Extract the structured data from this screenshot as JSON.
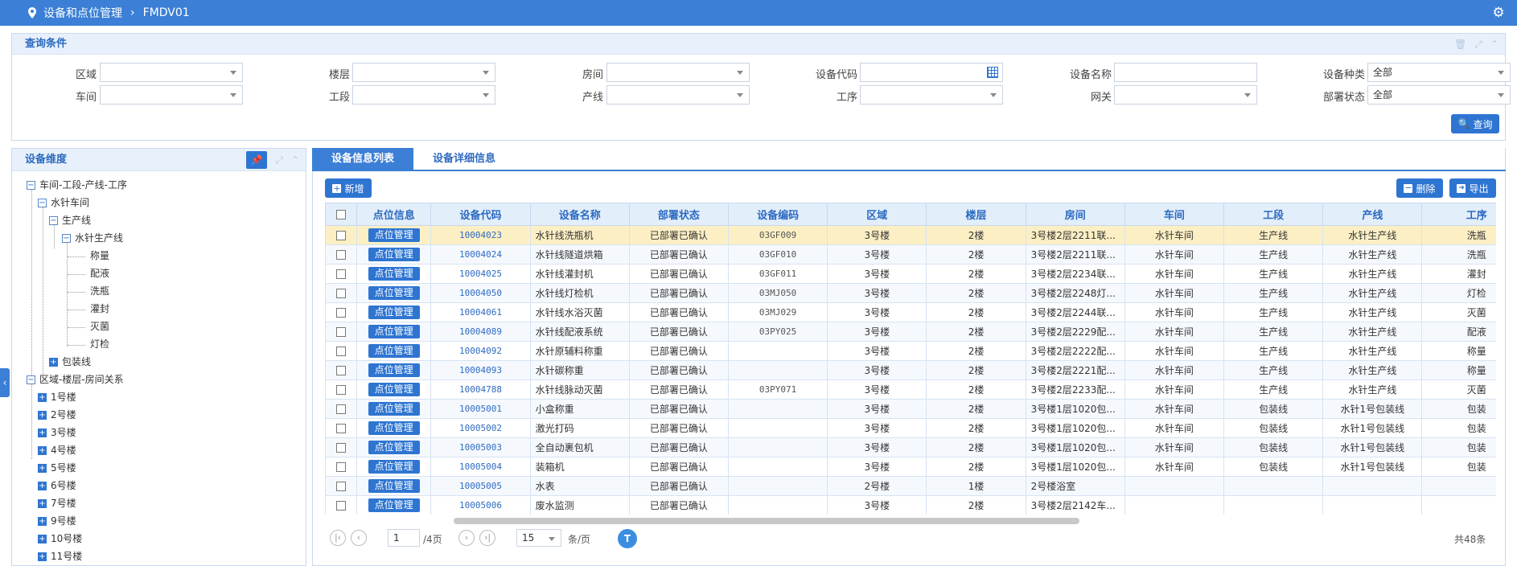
{
  "header": {
    "title": "设备和点位管理",
    "subtitle": "FMDV01"
  },
  "query": {
    "title": "查询条件",
    "row1": [
      {
        "label": "区域",
        "value": "",
        "type": "select"
      },
      {
        "label": "楼层",
        "value": "",
        "type": "select"
      },
      {
        "label": "房间",
        "value": "",
        "type": "select"
      },
      {
        "label": "设备代码",
        "value": "",
        "type": "calendar"
      },
      {
        "label": "设备名称",
        "value": "",
        "type": "text"
      },
      {
        "label": "设备种类",
        "value": "全部",
        "type": "select"
      }
    ],
    "row2": [
      {
        "label": "车间",
        "value": "",
        "type": "select"
      },
      {
        "label": "工段",
        "value": "",
        "type": "select"
      },
      {
        "label": "产线",
        "value": "",
        "type": "select"
      },
      {
        "label": "工序",
        "value": "",
        "type": "select"
      },
      {
        "label": "网关",
        "value": "",
        "type": "select"
      },
      {
        "label": "部署状态",
        "value": "全部",
        "type": "select"
      }
    ],
    "search_label": "查询"
  },
  "tree": {
    "title": "设备维度",
    "root1": "车间-工段-产线-工序",
    "workshop": "水针车间",
    "section": "生产线",
    "line": "水针生产线",
    "processes": [
      "称量",
      "配液",
      "洗瓶",
      "灌封",
      "灭菌",
      "灯检"
    ],
    "pack": "包装线",
    "root2": "区域-楼层-房间关系",
    "buildings": [
      "1号楼",
      "2号楼",
      "3号楼",
      "4号楼",
      "5号楼",
      "6号楼",
      "7号楼",
      "9号楼",
      "10号楼",
      "11号楼"
    ]
  },
  "tabs": [
    "设备信息列表",
    "设备详细信息"
  ],
  "toolbar": {
    "add": "新增",
    "delete": "删除",
    "export": "导出"
  },
  "columns": [
    "点位信息",
    "设备代码",
    "设备名称",
    "部署状态",
    "设备编码",
    "区域",
    "楼层",
    "房间",
    "车间",
    "工段",
    "产线",
    "工序"
  ],
  "point_button": "点位管理",
  "rows": [
    [
      "10004023",
      "水针线洗瓶机",
      "已部署已确认",
      "03GF009",
      "3号楼",
      "2楼",
      "3号楼2层2211联...",
      "水针车间",
      "生产线",
      "水针生产线",
      "洗瓶"
    ],
    [
      "10004024",
      "水针线隧道烘箱",
      "已部署已确认",
      "03GF010",
      "3号楼",
      "2楼",
      "3号楼2层2211联...",
      "水针车间",
      "生产线",
      "水针生产线",
      "洗瓶"
    ],
    [
      "10004025",
      "水针线灌封机",
      "已部署已确认",
      "03GF011",
      "3号楼",
      "2楼",
      "3号楼2层2234联...",
      "水针车间",
      "生产线",
      "水针生产线",
      "灌封"
    ],
    [
      "10004050",
      "水针线灯检机",
      "已部署已确认",
      "03MJ050",
      "3号楼",
      "2楼",
      "3号楼2层2248灯...",
      "水针车间",
      "生产线",
      "水针生产线",
      "灯检"
    ],
    [
      "10004061",
      "水针线水浴灭菌",
      "已部署已确认",
      "03MJ029",
      "3号楼",
      "2楼",
      "3号楼2层2244联...",
      "水针车间",
      "生产线",
      "水针生产线",
      "灭菌"
    ],
    [
      "10004089",
      "水针线配液系统",
      "已部署已确认",
      "03PY025",
      "3号楼",
      "2楼",
      "3号楼2层2229配...",
      "水针车间",
      "生产线",
      "水针生产线",
      "配液"
    ],
    [
      "10004092",
      "水针原辅料称重",
      "已部署已确认",
      "",
      "3号楼",
      "2楼",
      "3号楼2层2222配...",
      "水针车间",
      "生产线",
      "水针生产线",
      "称量"
    ],
    [
      "10004093",
      "水针碳称重",
      "已部署已确认",
      "",
      "3号楼",
      "2楼",
      "3号楼2层2221配...",
      "水针车间",
      "生产线",
      "水针生产线",
      "称量"
    ],
    [
      "10004788",
      "水针线脉动灭菌",
      "已部署已确认",
      "03PY071",
      "3号楼",
      "2楼",
      "3号楼2层2233配...",
      "水针车间",
      "生产线",
      "水针生产线",
      "灭菌"
    ],
    [
      "10005001",
      "小盒称重",
      "已部署已确认",
      "",
      "3号楼",
      "2楼",
      "3号楼1层1020包...",
      "水针车间",
      "包装线",
      "水针1号包装线",
      "包装"
    ],
    [
      "10005002",
      "激光打码",
      "已部署已确认",
      "",
      "3号楼",
      "2楼",
      "3号楼1层1020包...",
      "水针车间",
      "包装线",
      "水针1号包装线",
      "包装"
    ],
    [
      "10005003",
      "全自动裹包机",
      "已部署已确认",
      "",
      "3号楼",
      "2楼",
      "3号楼1层1020包...",
      "水针车间",
      "包装线",
      "水针1号包装线",
      "包装"
    ],
    [
      "10005004",
      "装箱机",
      "已部署已确认",
      "",
      "3号楼",
      "2楼",
      "3号楼1层1020包...",
      "水针车间",
      "包装线",
      "水针1号包装线",
      "包装"
    ],
    [
      "10005005",
      "水表",
      "已部署已确认",
      "",
      "2号楼",
      "1楼",
      "2号楼浴室",
      "",
      "",
      "",
      ""
    ],
    [
      "10005006",
      "废水监测",
      "已部署已确认",
      "",
      "3号楼",
      "2楼",
      "3号楼2层2142车...",
      "",
      "",
      "",
      ""
    ]
  ],
  "pager": {
    "page": "1",
    "total_pages": "/4页",
    "page_size": "15",
    "per_page": "条/页",
    "total": "共48条"
  }
}
